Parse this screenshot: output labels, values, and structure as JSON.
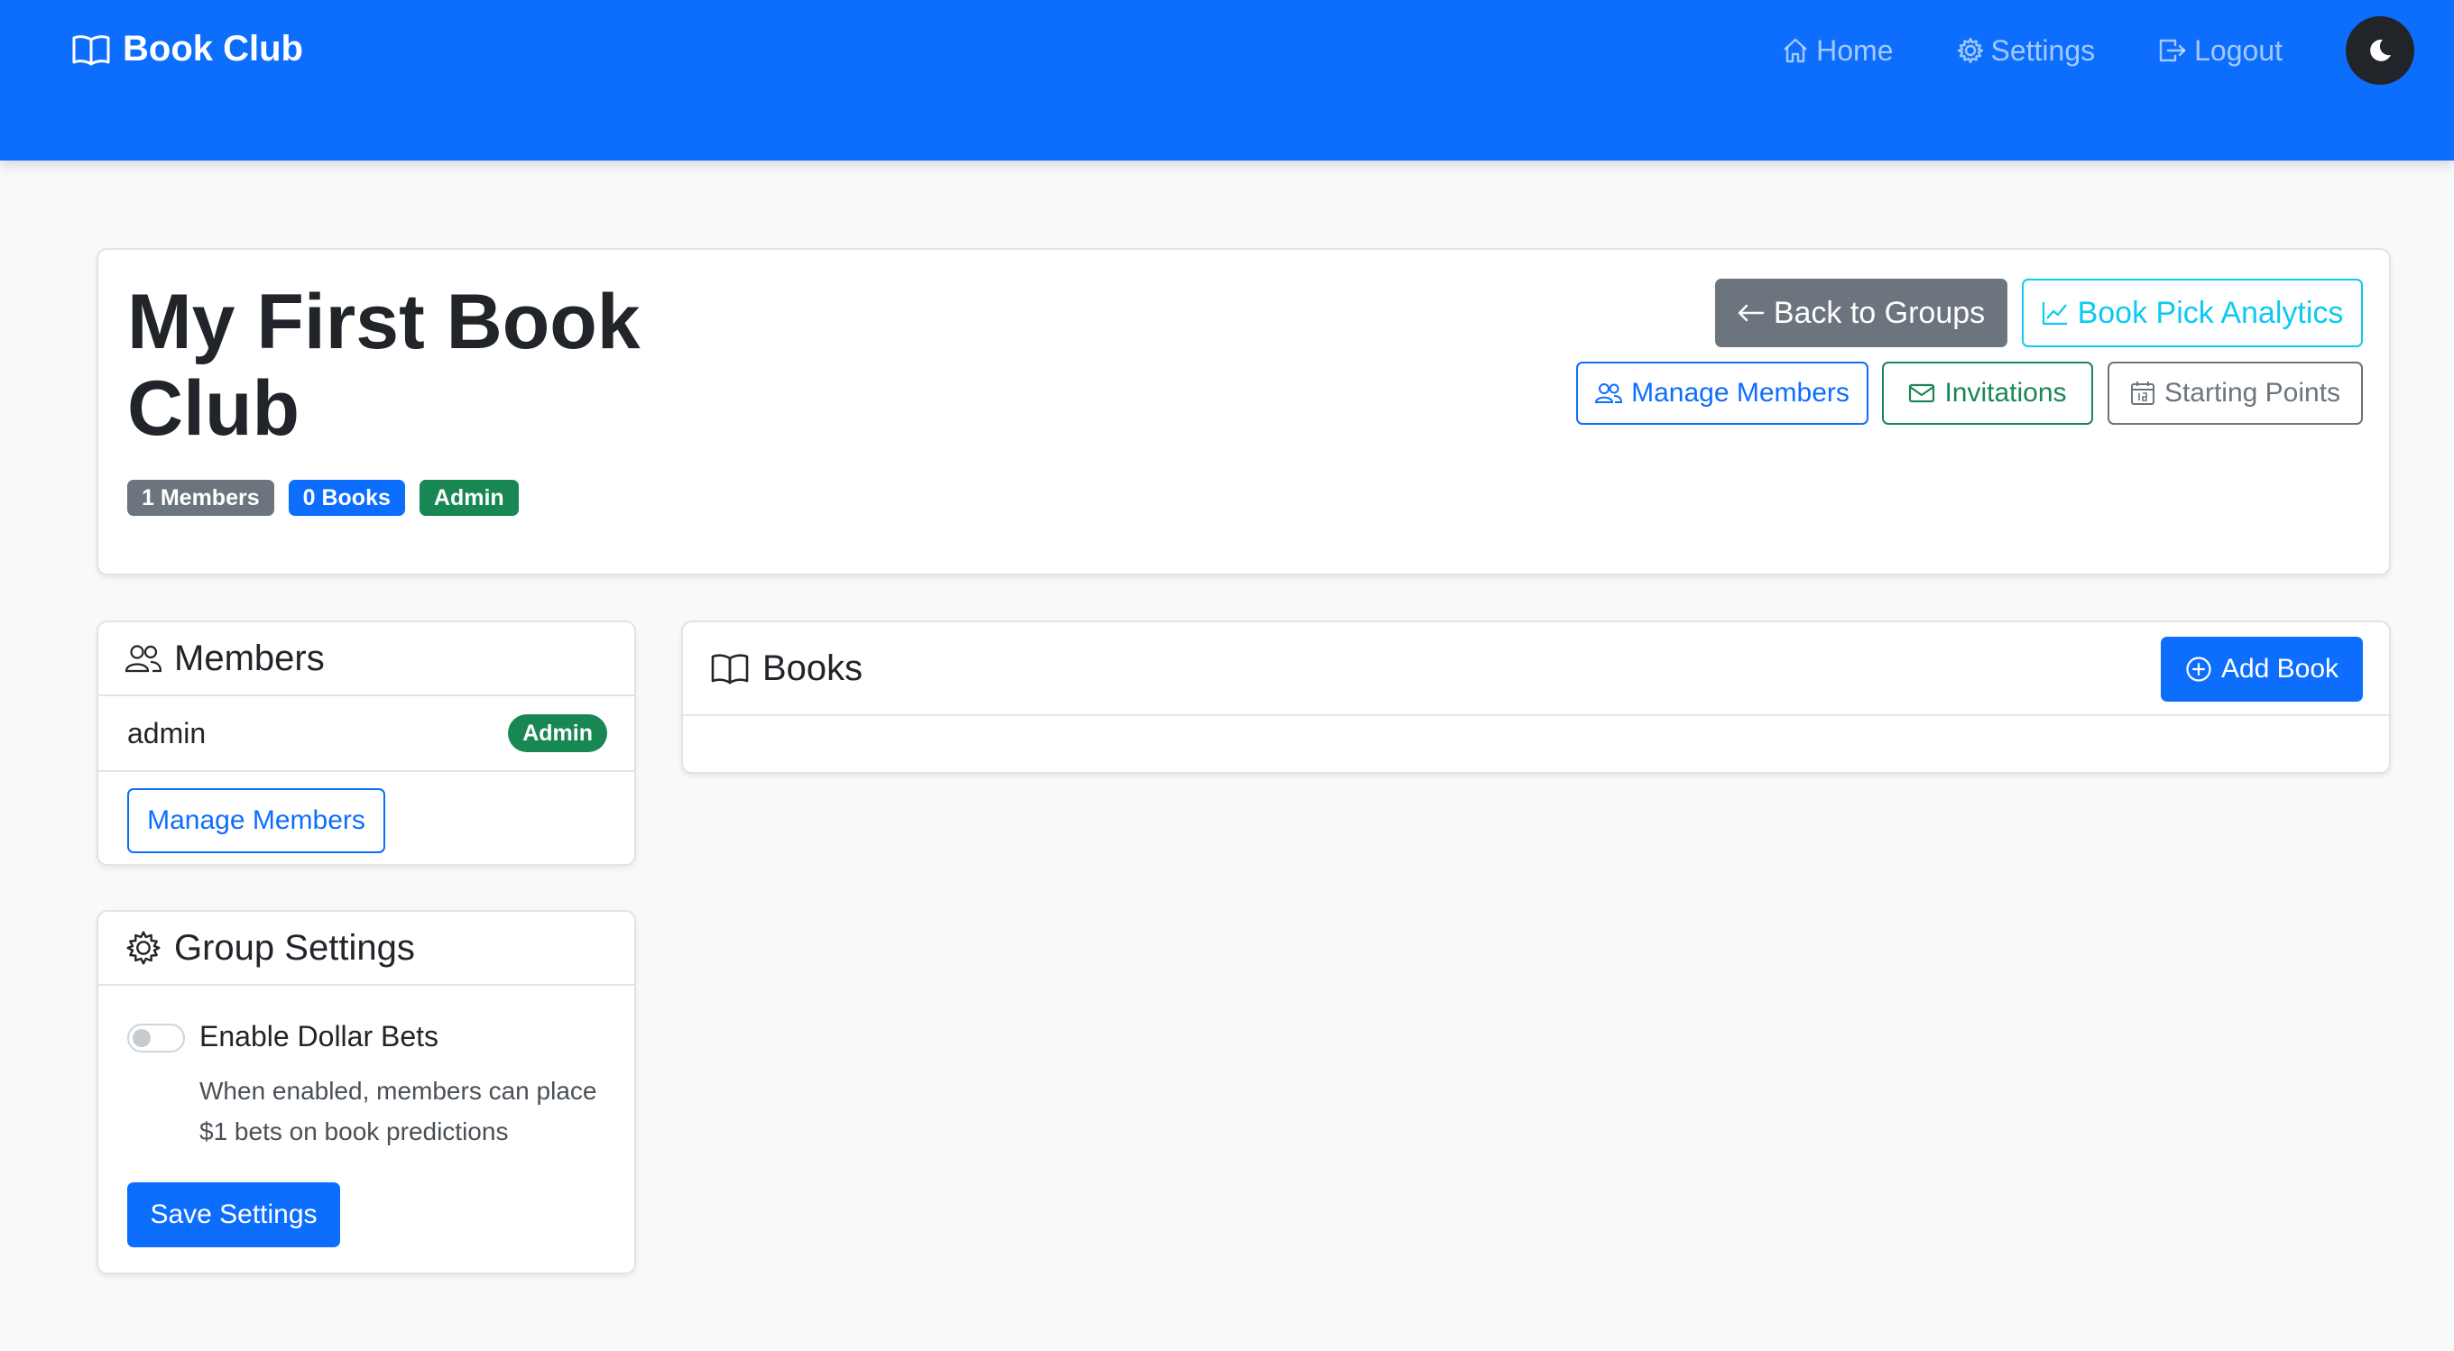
{
  "navbar": {
    "brand": "Book Club",
    "brand_icon": "book-icon",
    "links": [
      {
        "label": "Home",
        "icon": "house-icon"
      },
      {
        "label": "Settings",
        "icon": "gear-icon"
      },
      {
        "label": "Logout",
        "icon": "logout-icon"
      }
    ],
    "theme_toggle_icon": "moon-icon"
  },
  "group": {
    "title": "My First Book Club",
    "badges": {
      "members": "1 Members",
      "books": "0 Books",
      "role": "Admin"
    },
    "actions": {
      "back": "Back to Groups",
      "analytics": "Book Pick Analytics",
      "manage_members": "Manage Members",
      "invitations": "Invitations",
      "starting_points": "Starting Points"
    }
  },
  "members_panel": {
    "title": "Members",
    "members": [
      {
        "name": "admin",
        "role": "Admin"
      }
    ],
    "manage_button": "Manage Members"
  },
  "settings_panel": {
    "title": "Group Settings",
    "toggle_label": "Enable Dollar Bets",
    "toggle_checked": false,
    "help_text": "When enabled, members can place $1 bets on book predictions",
    "save_button": "Save Settings"
  },
  "books_panel": {
    "title": "Books",
    "add_button": "Add Book",
    "books": []
  },
  "colors": {
    "primary": "#0d6efd",
    "success": "#198754",
    "secondary": "#6c757d",
    "info": "#0dcaf0",
    "dark": "#212529",
    "page_background": "#f8f9fa"
  }
}
